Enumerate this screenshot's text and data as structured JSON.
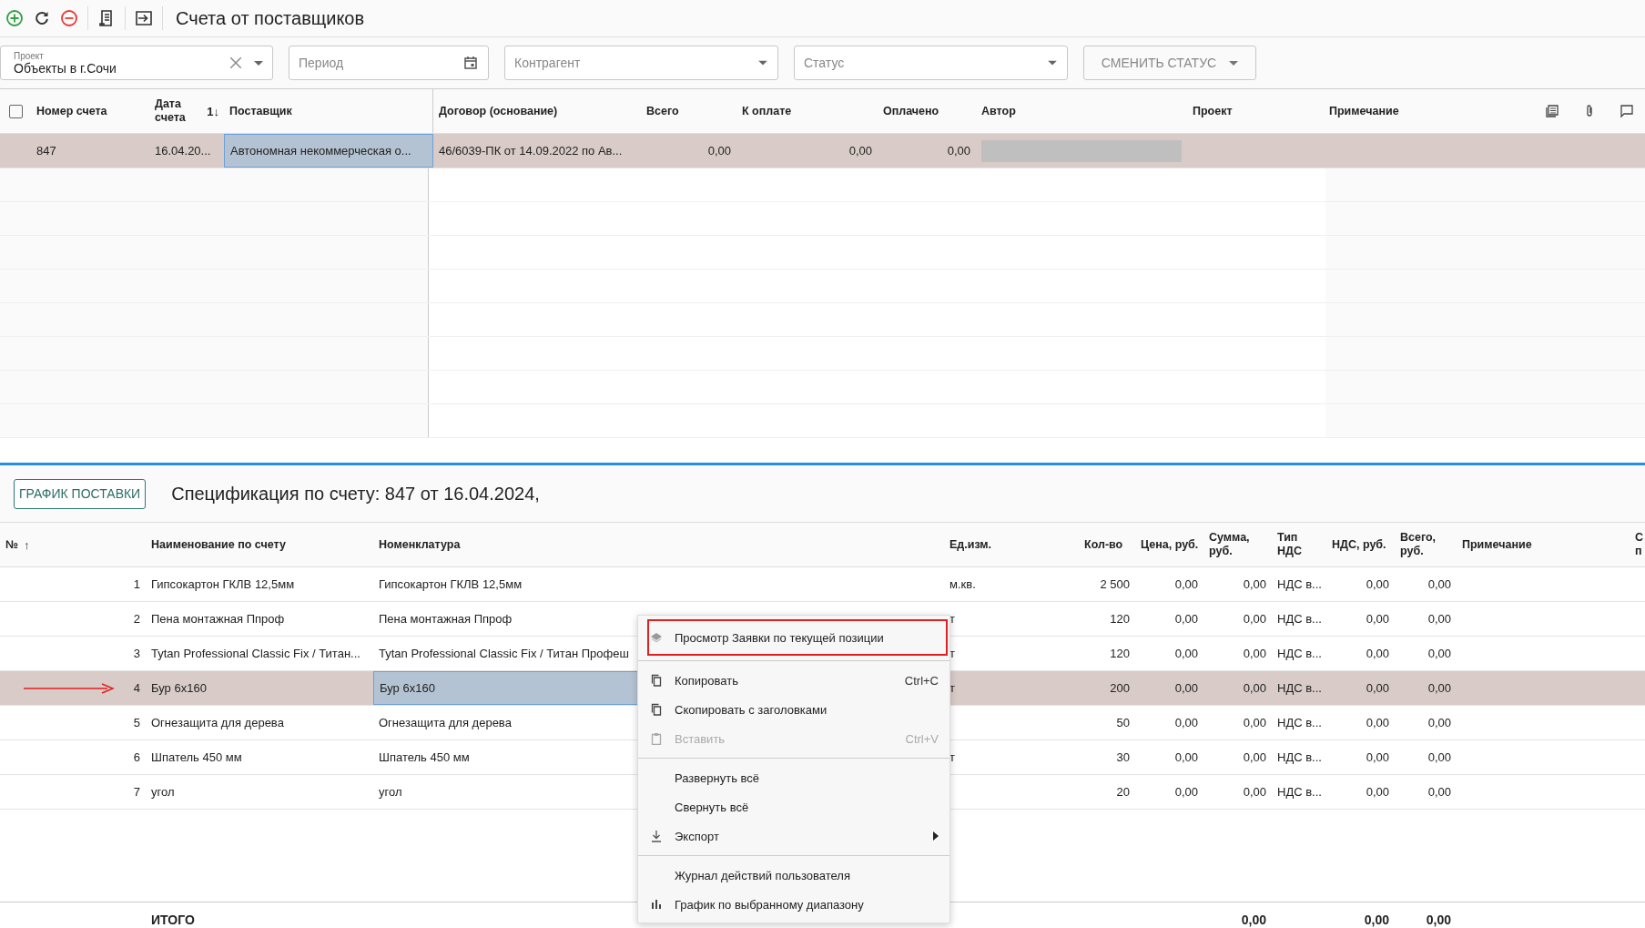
{
  "window": {
    "title": "Счета от поставщиков"
  },
  "filters": {
    "project": {
      "label": "Проект",
      "value": "Объекты в г.Сочи"
    },
    "period": {
      "placeholder": "Период"
    },
    "counterparty": {
      "placeholder": "Контрагент"
    },
    "status": {
      "placeholder": "Статус"
    },
    "change_status_button": "СМЕНИТЬ СТАТУС"
  },
  "invoices": {
    "select_all_checked": false,
    "columns": [
      {
        "label": "Номер счета"
      },
      {
        "label": "Дата счета",
        "sort_label": "1↓"
      },
      {
        "label": "Поставщик"
      },
      {
        "label": "Договор (основание)"
      },
      {
        "label": "Всего"
      },
      {
        "label": "К оплате"
      },
      {
        "label": "Оплачено"
      },
      {
        "label": "Автор"
      },
      {
        "label": "Проект"
      },
      {
        "label": "Примечание"
      }
    ],
    "rows": [
      {
        "number": "847",
        "date": "16.04.20...",
        "supplier": "Автономная некоммерческая о...",
        "contract": "46/6039-ПК от 14.09.2022 по Ав...",
        "total": "0,00",
        "to_pay": "0,00",
        "paid": "0,00",
        "author_redacted": true,
        "selected": true,
        "focused": true
      }
    ]
  },
  "specification": {
    "schedule_button": "ГРАФИК ПОСТАВКИ",
    "title": "Спецификация по счету: 847 от 16.04.2024,",
    "columns": [
      {
        "label": "№",
        "sort_label": "↑"
      },
      {
        "label": "Наименование по счету"
      },
      {
        "label": "Номенклатура"
      },
      {
        "label": "Ед.изм."
      },
      {
        "label": "Кол-во"
      },
      {
        "label": "Цена, руб."
      },
      {
        "label": "Сумма, руб."
      },
      {
        "label": "Тип НДС"
      },
      {
        "label": "НДС, руб."
      },
      {
        "label": "Всего, руб."
      },
      {
        "label": "Примечание"
      },
      {
        "label": "С п"
      }
    ],
    "rows": [
      {
        "no": "1",
        "name": "Гипсокартон ГКЛВ 12,5мм",
        "nomenclature": "Гипсокартон ГКЛВ 12,5мм",
        "unit": "м.кв.",
        "qty": "2 500",
        "price": "0,00",
        "sum": "0,00",
        "vat_type": "НДС в...",
        "vat": "0,00",
        "total": "0,00",
        "selected": false,
        "pointed": false
      },
      {
        "no": "2",
        "name": "Пена монтажная Ппроф",
        "nomenclature": "Пена монтажная Ппроф",
        "unit": "т",
        "qty": "120",
        "price": "0,00",
        "sum": "0,00",
        "vat_type": "НДС в...",
        "vat": "0,00",
        "total": "0,00",
        "selected": false,
        "pointed": false
      },
      {
        "no": "3",
        "name": "Tytan Professional Classic Fix / Титан...",
        "nomenclature": "Tytan Professional Classic Fix / Титан Профеш",
        "unit": "т",
        "qty": "120",
        "price": "0,00",
        "sum": "0,00",
        "vat_type": "НДС в...",
        "vat": "0,00",
        "total": "0,00",
        "selected": false,
        "pointed": false
      },
      {
        "no": "4",
        "name": "Бур 6х160",
        "nomenclature": "Бур 6х160",
        "unit": "т",
        "qty": "200",
        "price": "0,00",
        "sum": "0,00",
        "vat_type": "НДС в...",
        "vat": "0,00",
        "total": "0,00",
        "selected": true,
        "pointed": true,
        "focused": true
      },
      {
        "no": "5",
        "name": "Огнезащита для дерева",
        "nomenclature": "Огнезащита для дерева",
        "qty": "50",
        "price": "0,00",
        "sum": "0,00",
        "vat_type": "НДС в...",
        "vat": "0,00",
        "total": "0,00",
        "selected": false,
        "pointed": false
      },
      {
        "no": "6",
        "name": "Шпатель 450 мм",
        "nomenclature": "Шпатель 450 мм",
        "unit": "т",
        "qty": "30",
        "price": "0,00",
        "sum": "0,00",
        "vat_type": "НДС в...",
        "vat": "0,00",
        "total": "0,00",
        "selected": false,
        "pointed": false
      },
      {
        "no": "7",
        "name": "угол",
        "nomenclature": "угол",
        "qty": "20",
        "price": "0,00",
        "sum": "0,00",
        "vat_type": "НДС в...",
        "vat": "0,00",
        "total": "0,00",
        "selected": false,
        "pointed": false
      }
    ],
    "totals": {
      "name": "ИТОГО",
      "sum": "0,00",
      "vat": "0,00",
      "total": "0,00"
    }
  },
  "context_menu": [
    {
      "kind": "item",
      "label": "Просмотр Заявки по текущей позиции",
      "disabled": false,
      "highlighted": true
    },
    {
      "kind": "separator"
    },
    {
      "kind": "item",
      "label": "Копировать",
      "shortcut": "Ctrl+C",
      "disabled": false,
      "highlighted": false
    },
    {
      "kind": "item",
      "label": "Скопировать с заголовками",
      "disabled": false,
      "highlighted": false
    },
    {
      "kind": "item",
      "label": "Вставить",
      "shortcut": "Ctrl+V",
      "disabled": true,
      "highlighted": false
    },
    {
      "kind": "separator"
    },
    {
      "kind": "item",
      "label": "Развернуть всё",
      "disabled": false,
      "highlighted": false
    },
    {
      "kind": "item",
      "label": "Свернуть всё",
      "disabled": false,
      "highlighted": false
    },
    {
      "kind": "item",
      "label": "Экспорт",
      "disabled": false,
      "highlighted": false,
      "submenu": true
    },
    {
      "kind": "separator"
    },
    {
      "kind": "item",
      "label": "Журнал действий пользователя",
      "disabled": false,
      "highlighted": false
    },
    {
      "kind": "item",
      "label": "График по выбранному диапазону",
      "disabled": false,
      "highlighted": false
    }
  ]
}
